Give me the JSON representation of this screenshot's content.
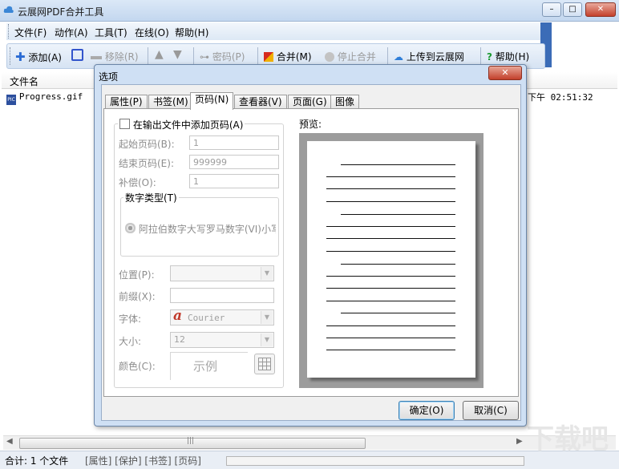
{
  "window": {
    "title": "云展网PDF合并工具",
    "buttons": {
      "minimize": "–",
      "maximize": "□",
      "close": "✕"
    }
  },
  "menu": [
    "文件(F)",
    "动作(A)",
    "工具(T)",
    "在线(O)",
    "帮助(H)"
  ],
  "toolbar": {
    "add": "添加(A)",
    "remove": "移除(R)",
    "password": "密码(P)",
    "merge": "合并(M)",
    "stop": "停止合并",
    "upload": "上传到云展网",
    "help": "帮助(H)"
  },
  "list": {
    "header": "文件名",
    "rows": [
      {
        "name": "Progress.gif",
        "time": "下午 02:51:32"
      }
    ]
  },
  "status": {
    "count": "合计: 1 个文件",
    "tags": "[属性] [保护] [书签] [页码]"
  },
  "watermark": "下载吧",
  "dialog": {
    "title": "选项",
    "close": "✕",
    "tabs": [
      "属性(P)",
      "书签(M)",
      "页码(N)",
      "查看器(V)",
      "页面(G)",
      "图像"
    ],
    "active_tab": "页码(N)",
    "page_number": {
      "add_checkbox": "在输出文件中添加页码(A)",
      "start_label": "起始页码(B):",
      "start_value": "1",
      "end_label": "结束页码(E):",
      "end_value": "999999",
      "offset_label": "补偿(O):",
      "offset_value": "1",
      "number_type_group": "数字类型(T)",
      "number_type_option": "阿拉伯数字大写罗马数字(VI)小写",
      "position_label": "位置(P):",
      "prefix_label": "前缀(X):",
      "font_label": "字体:",
      "font_value": "Courier",
      "size_label": "大小:",
      "size_value": "12",
      "color_label": "颜色(C):",
      "sample_text": "示例"
    },
    "preview_label": "预览:",
    "ok_button": "确定(O)",
    "cancel_button": "取消(C)"
  }
}
